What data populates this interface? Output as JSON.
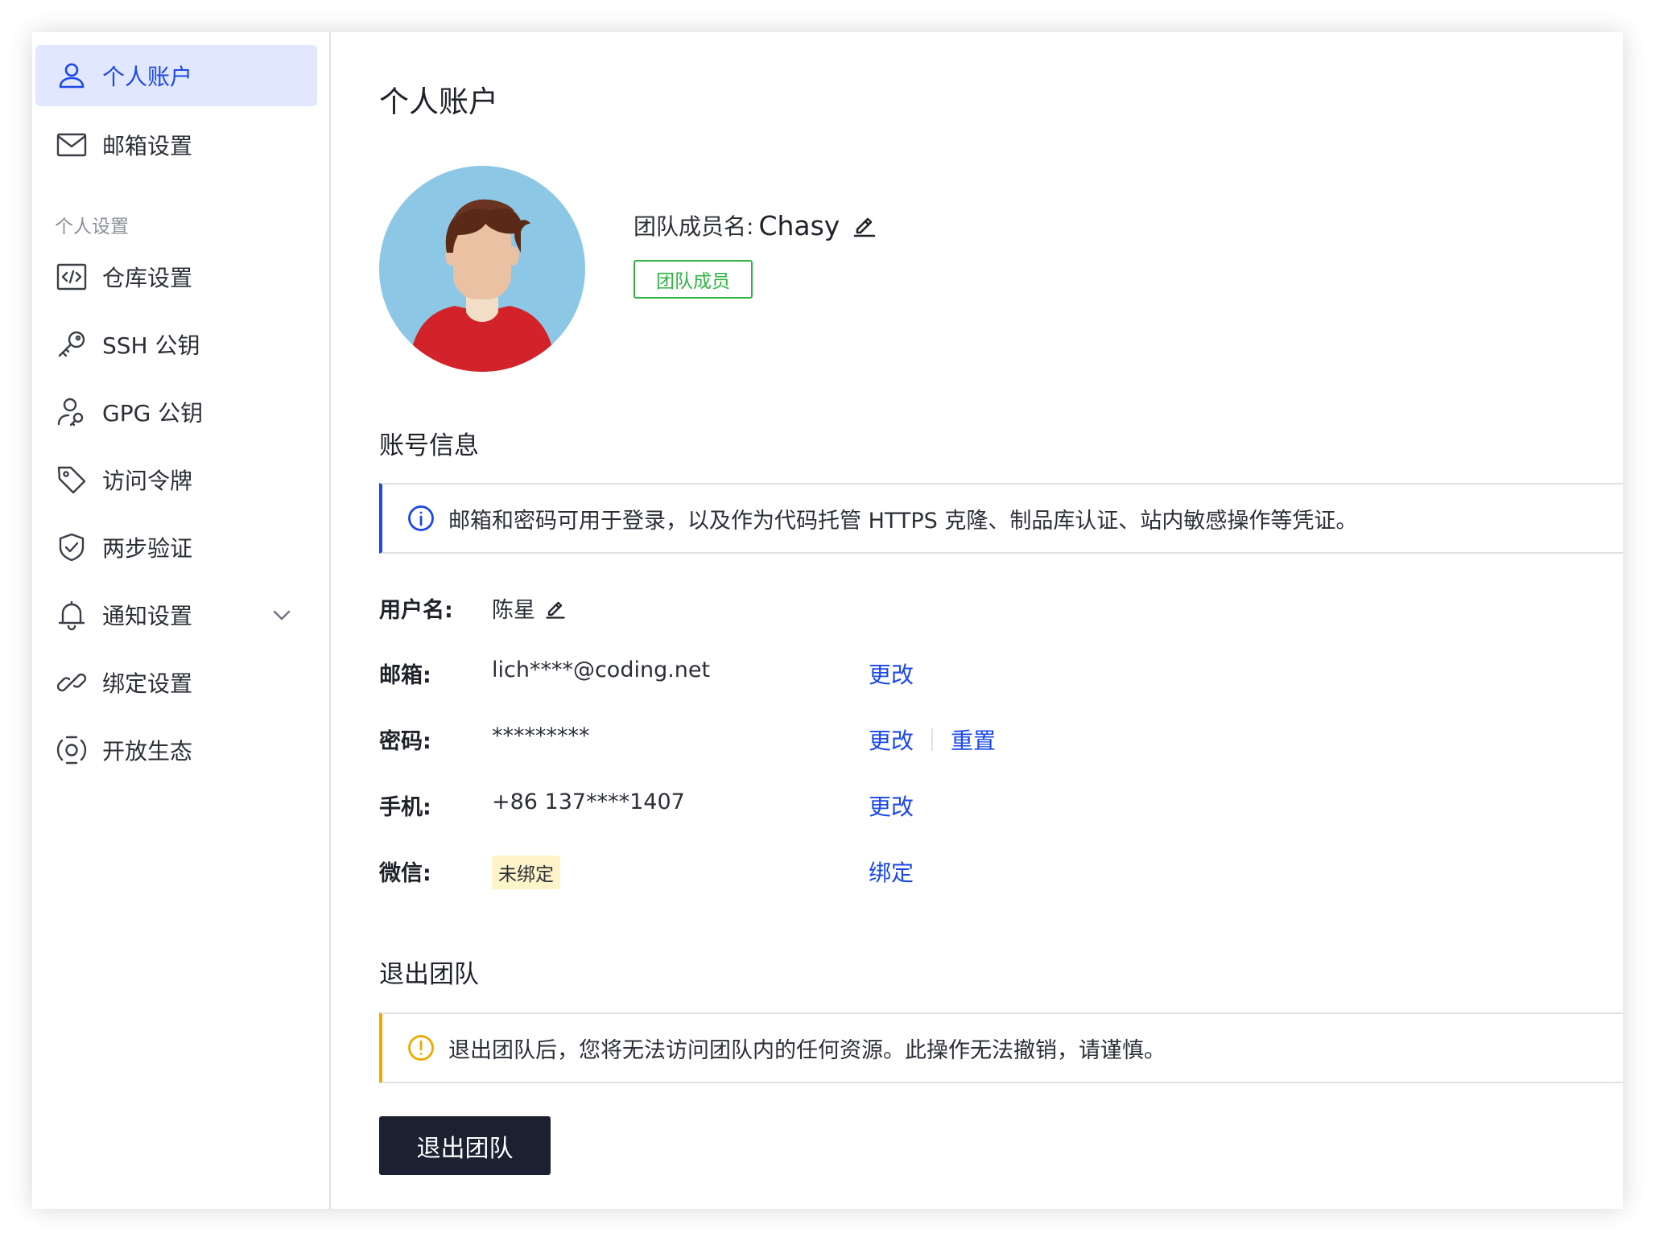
{
  "sidebar": {
    "items_top": [
      {
        "label": "个人账户",
        "icon": "user-icon",
        "active": true
      },
      {
        "label": "邮箱设置",
        "icon": "mail-icon",
        "active": false
      }
    ],
    "group_label": "个人设置",
    "items": [
      {
        "label": "仓库设置",
        "icon": "code-icon"
      },
      {
        "label": "SSH 公钥",
        "icon": "key-icon"
      },
      {
        "label": "GPG 公钥",
        "icon": "user-key-icon"
      },
      {
        "label": "访问令牌",
        "icon": "tag-icon"
      },
      {
        "label": "两步验证",
        "icon": "shield-check-icon"
      },
      {
        "label": "通知设置",
        "icon": "bell-icon"
      },
      {
        "label": "绑定设置",
        "icon": "link-icon"
      },
      {
        "label": "开放生态",
        "icon": "target-icon"
      }
    ]
  },
  "main": {
    "page_title": "个人账户",
    "profile": {
      "member_label": "团队成员名:",
      "member_name": "Chasy",
      "role_badge": "团队成员"
    },
    "account": {
      "section_title": "账号信息",
      "info_alert": "邮箱和密码可用于登录，以及作为代码托管 HTTPS 克隆、制品库认证、站内敏感操作等凭证。",
      "rows": {
        "username": {
          "key": "用户名:",
          "value": "陈星"
        },
        "email": {
          "key": "邮箱:",
          "value": "lich****@coding.net",
          "action": "更改"
        },
        "password": {
          "key": "密码:",
          "value": "*********",
          "action": "更改",
          "action2": "重置"
        },
        "phone": {
          "key": "手机:",
          "value": "+86 137****1407",
          "action": "更改"
        },
        "wechat": {
          "key": "微信:",
          "value": "未绑定",
          "action": "绑定"
        }
      }
    },
    "leave": {
      "section_title": "退出团队",
      "warn_alert": "退出团队后，您将无法访问团队内的任何资源。此操作无法撤销，请谨慎。",
      "button_label": "退出团队"
    }
  },
  "colors": {
    "accent": "#1b48e8",
    "active_bg": "#e1e7ff",
    "success": "#2fb344",
    "warning": "#f0a800",
    "button_dark": "#1b2131"
  }
}
